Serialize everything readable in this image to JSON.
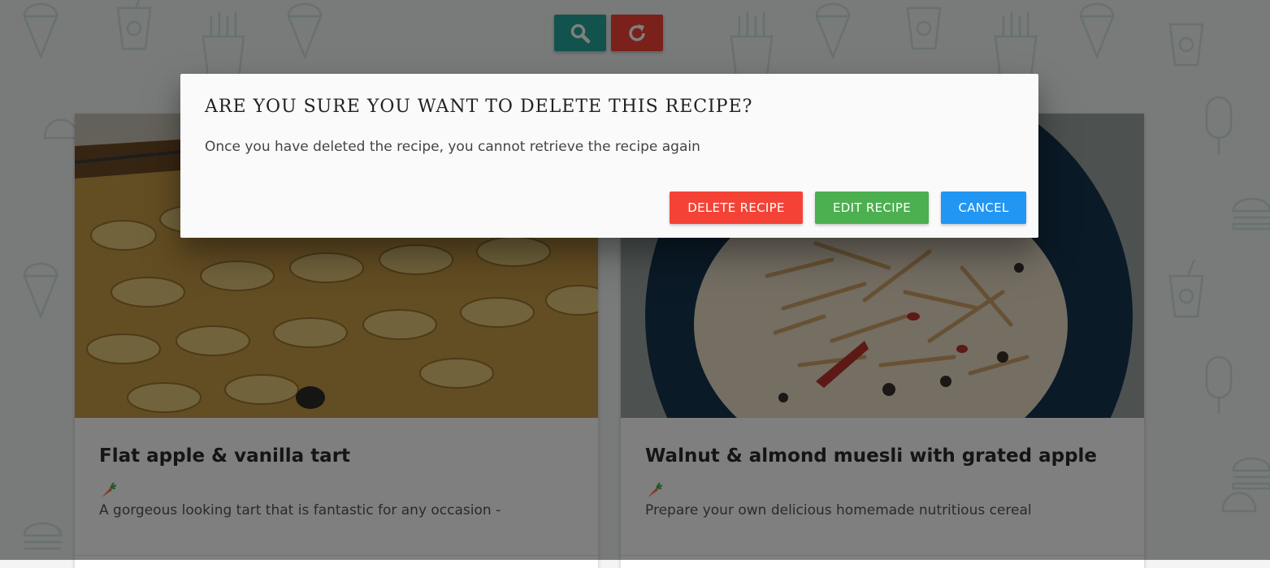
{
  "toolbar": {
    "search_icon": "search-icon",
    "refresh_icon": "refresh-icon"
  },
  "cards": [
    {
      "title": "Flat apple & vanilla tart",
      "diet_icon": "carrot-icon",
      "description": "A gorgeous looking tart that is fantastic for any occasion -"
    },
    {
      "title": "Walnut & almond muesli with grated apple",
      "diet_icon": "carrot-icon",
      "description": "Prepare your own delicious homemade nutritious cereal"
    }
  ],
  "modal": {
    "title": "ARE YOU SURE YOU WANT TO DELETE THIS RECIPE?",
    "message": "Once you have deleted the recipe, you cannot retrieve the recipe again",
    "delete_label": "DELETE RECIPE",
    "edit_label": "EDIT RECIPE",
    "cancel_label": "CANCEL"
  },
  "colors": {
    "search_button": "#26a69a",
    "refresh_button": "#f44336",
    "delete_button": "#f44336",
    "edit_button": "#4caf50",
    "cancel_button": "#2196f3"
  }
}
